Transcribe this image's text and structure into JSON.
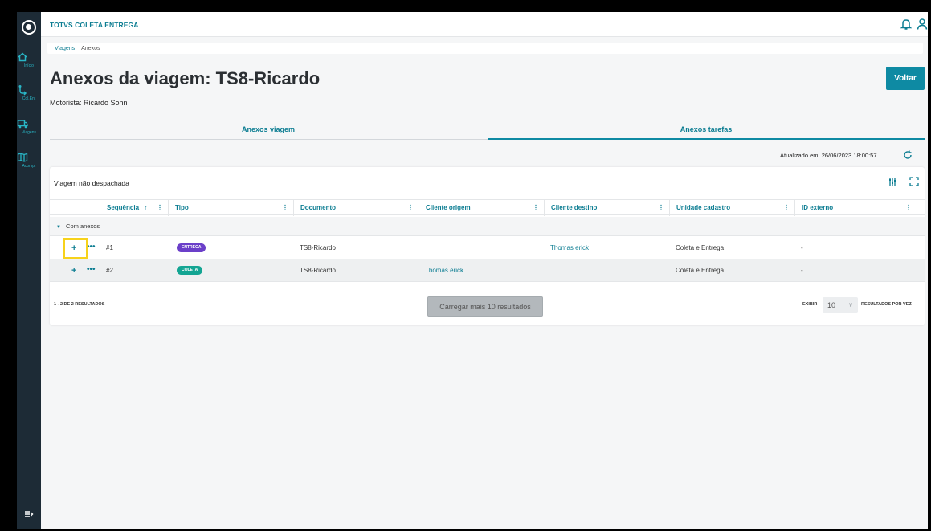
{
  "app": {
    "title": "TOTVS COLETA ENTREGA"
  },
  "sidebar": {
    "items": [
      {
        "label": "Início",
        "icon": "home-icon"
      },
      {
        "label": "Col.Ent",
        "icon": "route-icon"
      },
      {
        "label": "Viagens",
        "icon": "truck-icon"
      },
      {
        "label": "Acomp.",
        "icon": "map-icon"
      }
    ],
    "bottom_icon": "expand-menu-icon"
  },
  "breadcrumb": {
    "items": [
      "Viagens",
      "Anexos"
    ]
  },
  "page": {
    "title": "Anexos da viagem: TS8-Ricardo",
    "motorista": "Motorista: Ricardo Sohn",
    "back_button": "Voltar"
  },
  "tabs": [
    {
      "label": "Anexos viagem",
      "active": false
    },
    {
      "label": "Anexos tarefas",
      "active": true
    }
  ],
  "updated": "Atualizado em: 26/06/2023 18:00:57",
  "table": {
    "title": "Viagem não despachada",
    "columns": [
      "Sequência",
      "Tipo",
      "Documento",
      "Cliente origem",
      "Cliente destino",
      "Unidade cadastro",
      "ID externo"
    ],
    "sort_indicator": "↑",
    "group_label": "Com anexos",
    "rows": [
      {
        "seq": "#1",
        "tipo": "ENTREGA",
        "tipo_color": "#6b3fc9",
        "documento": "TS8-Ricardo",
        "cliente_origem": "",
        "cliente_destino": "Thomas erick",
        "unidade": "Coleta e Entrega",
        "id_externo": "-"
      },
      {
        "seq": "#2",
        "tipo": "COLETA",
        "tipo_color": "#13a593",
        "documento": "TS8-Ricardo",
        "cliente_origem": "Thomas erick",
        "cliente_destino": "",
        "unidade": "Coleta e Entrega",
        "id_externo": "-"
      }
    ],
    "results_count": "1 - 2 DE 2 RESULTADOS",
    "load_more": "Carregar mais 10 resultados",
    "exibir": "EXIBIR",
    "per_page": "10",
    "per_page_label": "RESULTADOS POR VEZ"
  },
  "colors": {
    "primary": "#0e8aa3",
    "sidebar": "#1d2b36",
    "highlight": "#f7d21b"
  }
}
